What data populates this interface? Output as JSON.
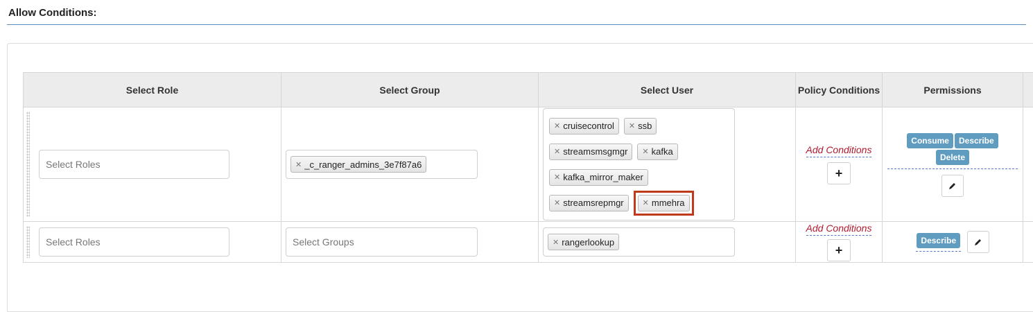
{
  "section": {
    "title": "Allow Conditions:"
  },
  "table": {
    "headers": [
      "Select Role",
      "Select Group",
      "Select User",
      "Policy Conditions",
      "Permissions"
    ]
  },
  "rows": [
    {
      "role_placeholder": "Select Roles",
      "groups": [
        "_c_ranger_admins_3e7f87a6"
      ],
      "group_placeholder": "",
      "users": [
        "cruisecontrol",
        "ssb",
        "streamsmsgmgr",
        "kafka",
        "kafka_mirror_maker",
        "streamsrepmgr",
        "mmehra"
      ],
      "highlighted_user": "mmehra",
      "conditions_label": "Add Conditions",
      "permissions": [
        "Consume",
        "Describe",
        "Delete"
      ]
    },
    {
      "role_placeholder": "Select Roles",
      "groups": [],
      "group_placeholder": "Select Groups",
      "users": [
        "rangerlookup"
      ],
      "conditions_label": "Add Conditions",
      "permissions": [
        "Describe"
      ]
    }
  ],
  "colors": {
    "highlight": "#c0391b",
    "permission_badge": "#5f9cc0",
    "add_conditions": "#b11a2e",
    "rule": "#5a8fc0"
  },
  "icons": {
    "remove": "×",
    "add": "+",
    "edit": "pencil-icon"
  }
}
